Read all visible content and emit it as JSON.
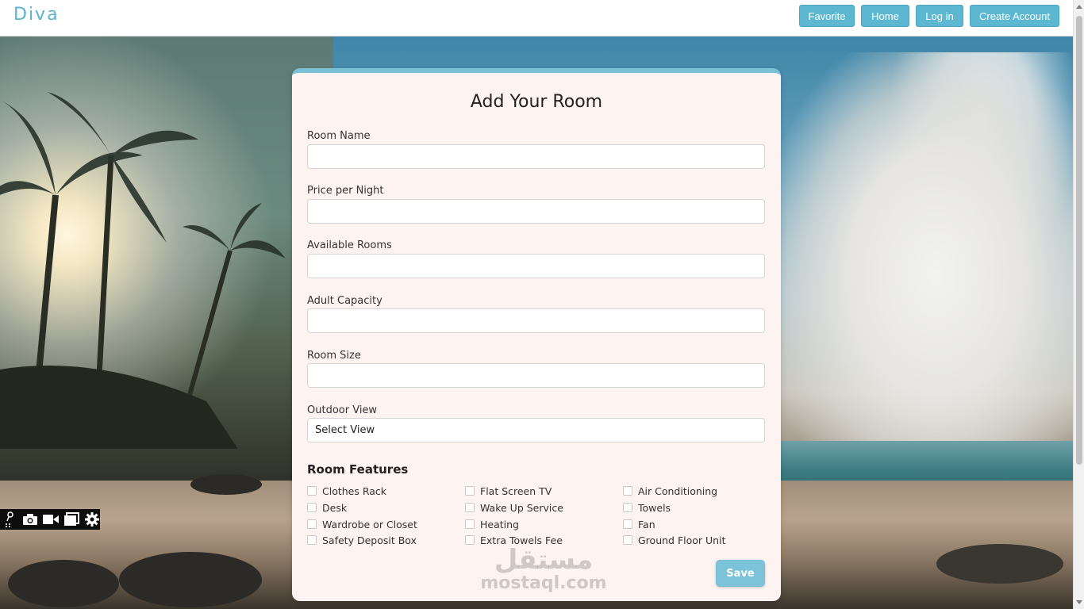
{
  "navbar": {
    "brand": "Diva",
    "buttons": [
      "Favorite",
      "Home",
      "Log in",
      "Create Account"
    ]
  },
  "form": {
    "title": "Add Your Room",
    "fields": [
      {
        "label": "Room Name",
        "value": ""
      },
      {
        "label": "Price per Night",
        "value": ""
      },
      {
        "label": "Available Rooms",
        "value": ""
      },
      {
        "label": "Adult Capacity",
        "value": ""
      },
      {
        "label": "Room Size",
        "value": ""
      }
    ],
    "outdoor_view": {
      "label": "Outdoor View",
      "selected": "Select View"
    },
    "features_title": "Room Features",
    "features": [
      "Clothes Rack",
      "Flat Screen TV",
      "Air Conditioning",
      "Desk",
      "Wake Up Service",
      "Towels",
      "Wardrobe or Closet",
      "Heating",
      "Fan",
      "Safety Deposit Box",
      "Extra Towels Fee",
      "Ground Floor Unit"
    ],
    "save_label": "Save"
  },
  "watermark": {
    "arabic": "مستقل",
    "latin": "mostaql.com"
  },
  "toolbar": {
    "icons": [
      "pin-icon",
      "camera-icon",
      "video-icon",
      "window-icon",
      "gear-icon"
    ]
  },
  "colors": {
    "accent": "#5bb8d0",
    "card_bg": "#fdf3f0",
    "brand": "#5ab4cf"
  }
}
